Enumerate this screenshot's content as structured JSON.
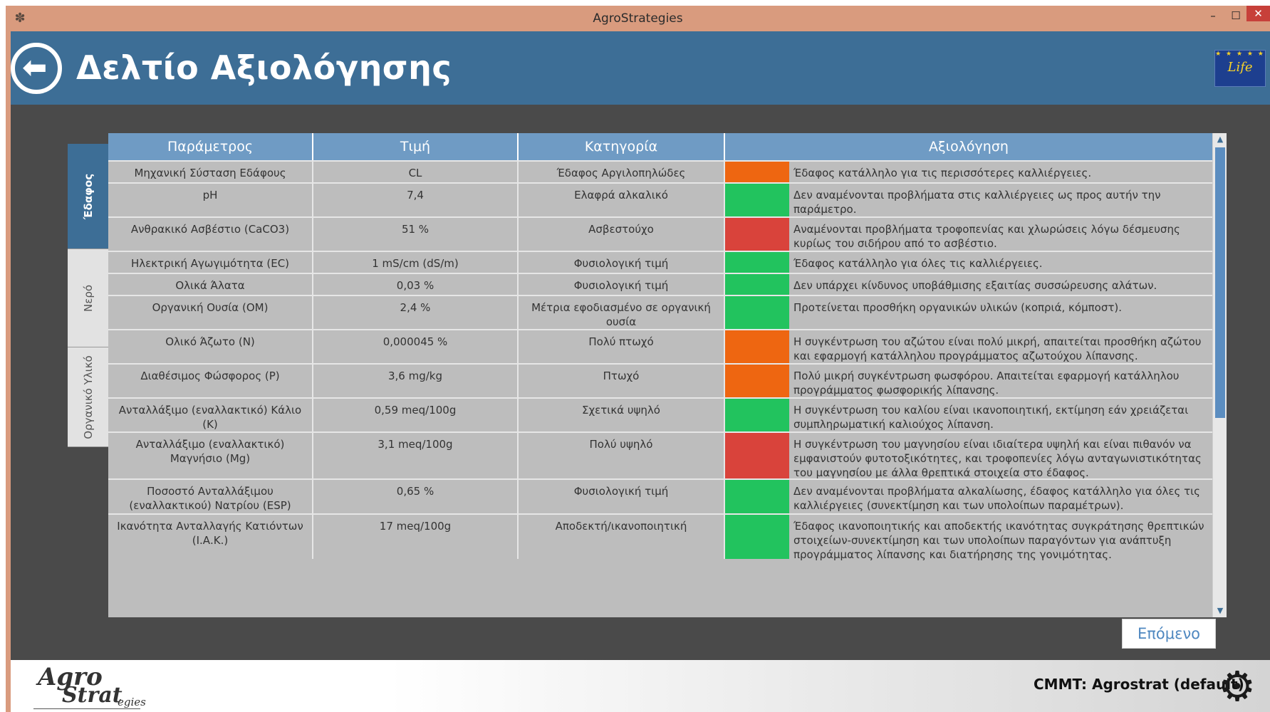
{
  "window": {
    "title": "AgroStrategies",
    "minimize": "–",
    "maximize": "☐",
    "close": "✕"
  },
  "header": {
    "title": "Δελτίο Αξιολόγησης",
    "back_icon": "back-arrow-icon",
    "logo_text": "Life"
  },
  "tabs": [
    {
      "label": "Έδαφος",
      "active": true
    },
    {
      "label": "Νερό",
      "active": false
    },
    {
      "label": "Οργανικό Υλικό",
      "active": false
    }
  ],
  "table": {
    "columns": [
      "Παράμετρος",
      "Τιμή",
      "Κατηγορία",
      "Αξιολόγηση"
    ],
    "colors": {
      "orange": "#ee6611",
      "green": "#22c35e",
      "red": "#d9433b"
    },
    "rows": [
      {
        "parameter": "Μηχανική Σύσταση Εδάφους",
        "value": "CL",
        "category": "Έδαφος Αργιλοπηλώδες",
        "status": "orange",
        "assessment": "Έδαφος κατάλληλο για τις περισσότερες καλλιέργειες."
      },
      {
        "parameter": "pH",
        "value": "7,4",
        "category": "Ελαφρά αλκαλικό",
        "status": "green",
        "assessment": "Δεν αναμένονται προβλήματα στις καλλιέργειες ως προς αυτήν την παράμετρο."
      },
      {
        "parameter": "Ανθρακικό Ασβέστιο (CaCO3)",
        "value": "51 %",
        "category": "Ασβεστούχο",
        "status": "red",
        "assessment": "Αναμένονται προβλήματα τροφοπενίας και χλωρώσεις λόγω δέσμευσης κυρίως του σιδήρου από το ασβέστιο."
      },
      {
        "parameter": "Ηλεκτρική Αγωγιμότητα (EC)",
        "value": "1 mS/cm (dS/m)",
        "category": "Φυσιολογική τιμή",
        "status": "green",
        "assessment": "Έδαφος κατάλληλο για όλες τις καλλιέργειες."
      },
      {
        "parameter": "Ολικά Άλατα",
        "value": "0,03 %",
        "category": "Φυσιολογική τιμή",
        "status": "green",
        "assessment": "Δεν υπάρχει κίνδυνος υποβάθμισης εξαιτίας συσσώρευσης αλάτων."
      },
      {
        "parameter": "Οργανική Ουσία (ΟΜ)",
        "value": "2,4 %",
        "category": "Μέτρια εφοδιασμένο σε οργανική ουσία",
        "status": "green",
        "assessment": "Προτείνεται προσθήκη οργανικών υλικών (κοπριά, κόμποστ)."
      },
      {
        "parameter": "Ολικό Άζωτο (Ν)",
        "value": "0,000045 %",
        "category": "Πολύ πτωχό",
        "status": "orange",
        "assessment": "Η συγκέντρωση του αζώτου είναι πολύ μικρή, απαιτείται προσθήκη αζώτου και εφαρμογή κατάλληλου προγράμματος αζωτούχου λίπανσης."
      },
      {
        "parameter": "Διαθέσιμος Φώσφορος (P)",
        "value": "3,6 mg/kg",
        "category": "Πτωχό",
        "status": "orange",
        "assessment": "Πολύ μικρή συγκέντρωση φωσφόρου. Απαιτείται εφαρμογή κατάλληλου προγράμματος φωσφορικής λίπανσης."
      },
      {
        "parameter": "Ανταλλάξιμο (εναλλακτικό) Κάλιο (Κ)",
        "value": "0,59 meq/100g",
        "category": "Σχετικά υψηλό",
        "status": "green",
        "assessment": "Η συγκέντρωση του καλίου είναι ικανοποιητική, εκτίμηση εάν χρειάζεται συμπληρωματική καλιούχος λίπανση."
      },
      {
        "parameter": "Ανταλλάξιμο (εναλλακτικό) Μαγνήσιο (Mg)",
        "value": "3,1 meq/100g",
        "category": "Πολύ υψηλό",
        "status": "red",
        "assessment": "Η συγκέντρωση του μαγνησίου είναι ιδιαίτερα υψηλή και είναι πιθανόν να εμφανιστούν φυτοτοξικότητες, και τροφοπενίες λόγω  ανταγωνιστικότητας του μαγνησίου με άλλα θρεπτικά στοιχεία στο έδαφος."
      },
      {
        "parameter": "Ποσοστό Ανταλλάξιμου (εναλλακτικού) Νατρίου (ESP)",
        "value": "0,65 %",
        "category": "Φυσιολογική τιμή",
        "status": "green",
        "assessment": "Δεν αναμένονται προβλήματα αλκαλίωσης, έδαφος κατάλληλο για όλες τις καλλιέργειες (συνεκτίμηση και των υπολοίπων παραμέτρων)."
      },
      {
        "parameter": "Ικανότητα Ανταλλαγής Κατιόντων (Ι.Α.Κ.)",
        "value": "17 meq/100g",
        "category": "Αποδεκτή/ικανοποιητική",
        "status": "green",
        "assessment": "Έδαφος ικανοποιητικής και αποδεκτής ικανότητας συγκράτησης θρεπτικών στοιχείων-συνεκτίμηση και των υπολοίπων παραγόντων για ανάπτυξη προγράμματος λίπανσης και διατήρησης της γονιμότητας."
      }
    ]
  },
  "next_button": "Επόμενο",
  "footer": {
    "logo_agro": "Agro",
    "logo_strat": "Strat",
    "logo_egies": "egies",
    "profile": "CMMT: Agrostrat (default)",
    "settings_icon": "gear-icon"
  }
}
